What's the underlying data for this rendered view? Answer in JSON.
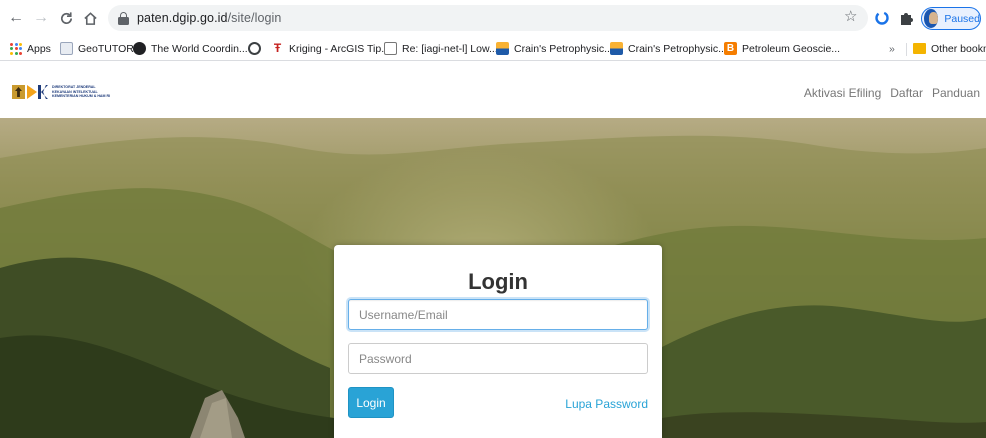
{
  "browser": {
    "url_host": "paten.dgip.go.id",
    "url_path": "/site/login",
    "profile_status": "Paused",
    "bookmarks": [
      {
        "label": "Apps",
        "icon": "apps-grid-icon"
      },
      {
        "label": "GeoTUTOR",
        "icon": "geotutor-favicon"
      },
      {
        "label": "The World Coordin...",
        "icon": "globe-favicon"
      },
      {
        "label": "",
        "icon": "circle-favicon"
      },
      {
        "label": "Kriging - ArcGIS Tip...",
        "icon": "arcgis-favicon"
      },
      {
        "label": "Re: [iagi-net-l] Low...",
        "icon": "mail-favicon"
      },
      {
        "label": "Crain's Petrophysic...",
        "icon": "crain-favicon"
      },
      {
        "label": "Crain's Petrophysic...",
        "icon": "crain-favicon"
      },
      {
        "label": "Petroleum Geoscie...",
        "icon": "blogger-favicon"
      }
    ],
    "overflow": "»",
    "other_bookmarks": "Other bookma"
  },
  "site": {
    "logo_text": [
      "DIREKTORAT JENDERAL",
      "KEKAYAAN INTELEKTUAL",
      "KEMENTERIAN HUKUM & HAM RI"
    ],
    "nav": [
      "Aktivasi Efiling",
      "Daftar",
      "Panduan"
    ]
  },
  "login": {
    "title": "Login",
    "username_placeholder": "Username/Email",
    "password_placeholder": "Password",
    "submit_label": "Login",
    "forgot_label": "Lupa Password"
  },
  "colors": {
    "accent": "#29a3d6",
    "focus_ring": "#66afe9",
    "profile_blue": "#1a73e8"
  }
}
